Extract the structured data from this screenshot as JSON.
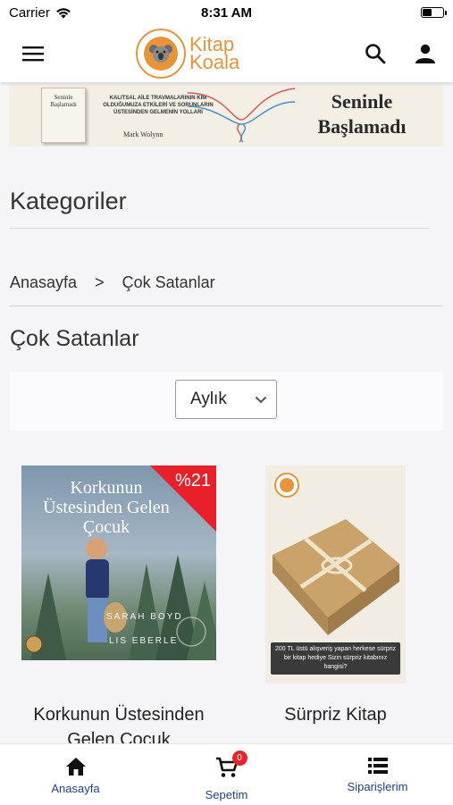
{
  "status_bar": {
    "carrier": "Carrier",
    "time": "8:31 AM"
  },
  "header": {
    "logo_line1": "Kitap",
    "logo_line2": "Koala",
    "brand_color": "#e8953a",
    "icons": [
      "menu-icon",
      "search-icon",
      "user-icon"
    ]
  },
  "banner": {
    "book_title": "Seninle Başlamadı",
    "subtitle": "KALITSAL AİLE TRAVMALARININ KİM OLDUĞUMUZA ETKİLERİ VE SORUNLARIN ÜSTESİNDEN GELMENİN YOLLARI",
    "author": "Mark Wolynn",
    "title_line1": "Seninle",
    "title_line2": "Başlamadı"
  },
  "categories_title": "Kategoriler",
  "breadcrumb": {
    "home": "Anasayfa",
    "separator": ">",
    "current": "Çok Satanlar"
  },
  "page_title": "Çok Satanlar",
  "filter": {
    "selected": "Aylık"
  },
  "products": [
    {
      "name": "Korkunun Üstesinden Gelen Çocuk",
      "cover_title_line1": "Korkunun",
      "cover_title_line2": "Üstesinden Gelen",
      "cover_title_line3": "Çocuk",
      "cover_author1": "SARAH BOYD",
      "cover_author2": "LIS EBERLE",
      "discount": "%21"
    },
    {
      "name": "Sürpriz Kitap",
      "cover_text": "200 TL üstü alışveriş yapan herkese sürpriz bir kitap hediye Sizin sürpriz kitabınız hangisi?"
    }
  ],
  "tabbar": {
    "home": "Anasayfa",
    "cart": "Sepetim",
    "cart_count": "0",
    "orders": "Siparişlerim",
    "accent": "#1f3f8a"
  }
}
